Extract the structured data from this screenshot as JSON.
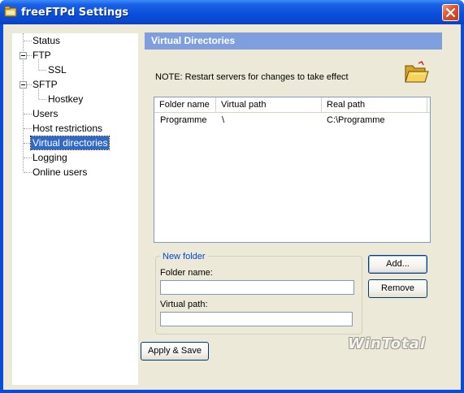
{
  "window": {
    "title": "freeFTPd Settings"
  },
  "tree": {
    "items": [
      {
        "label": "Status"
      },
      {
        "label": "FTP"
      },
      {
        "label": "SSL"
      },
      {
        "label": "SFTP"
      },
      {
        "label": "Hostkey"
      },
      {
        "label": "Users"
      },
      {
        "label": "Host restrictions"
      },
      {
        "label": "Virtual directories",
        "selected": true
      },
      {
        "label": "Logging"
      },
      {
        "label": "Online users"
      }
    ]
  },
  "panel": {
    "header": "Virtual Directories",
    "note": "NOTE: Restart servers for changes to take effect",
    "icon": "folder-icon"
  },
  "table": {
    "columns": [
      "Folder name",
      "Virtual path",
      "Real path"
    ],
    "rows": [
      [
        "Programme",
        "\\",
        "C:\\Programme"
      ]
    ]
  },
  "new_folder": {
    "legend": "New folder",
    "folder_name_label": "Folder name:",
    "folder_name_value": "",
    "virtual_path_label": "Virtual path:",
    "virtual_path_value": ""
  },
  "buttons": {
    "add": "Add...",
    "remove": "Remove",
    "apply_save": "Apply & Save"
  },
  "watermark": "WinTotal",
  "colors": {
    "titlebar": "#0a50da",
    "header_bar": "#7f9ede",
    "selection": "#316ac5",
    "close_button": "#e0512b"
  }
}
